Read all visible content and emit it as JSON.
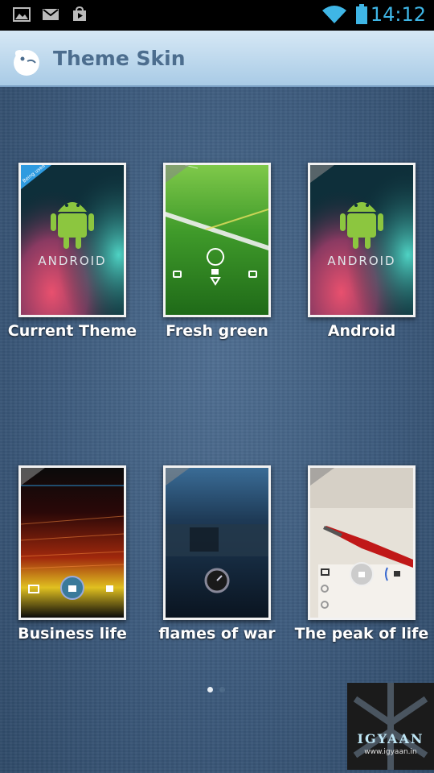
{
  "status_bar": {
    "time": "14:12",
    "icons": [
      "gallery-icon",
      "gmail-icon",
      "play-store-icon",
      "wifi-icon",
      "battery-icon"
    ]
  },
  "header": {
    "title": "Theme Skin",
    "logo_icon": "bird-logo-icon"
  },
  "themes": [
    {
      "label": "Current Theme",
      "badge": "Being used",
      "style": "android"
    },
    {
      "label": "Fresh green",
      "style": "green"
    },
    {
      "label": "Android",
      "style": "android"
    },
    {
      "label": "Business life",
      "style": "business"
    },
    {
      "label": "flames of war",
      "style": "war"
    },
    {
      "label": "The peak of life",
      "style": "peak"
    }
  ],
  "thumb_text": {
    "android_wordmark": "ANDROID"
  },
  "pager": {
    "current": 1,
    "total": 2
  },
  "watermark": {
    "brand": "IGYAAN",
    "url": "www.igyaan.in"
  },
  "colors": {
    "accent": "#3fb6e6",
    "title": "#4c6d8e"
  }
}
